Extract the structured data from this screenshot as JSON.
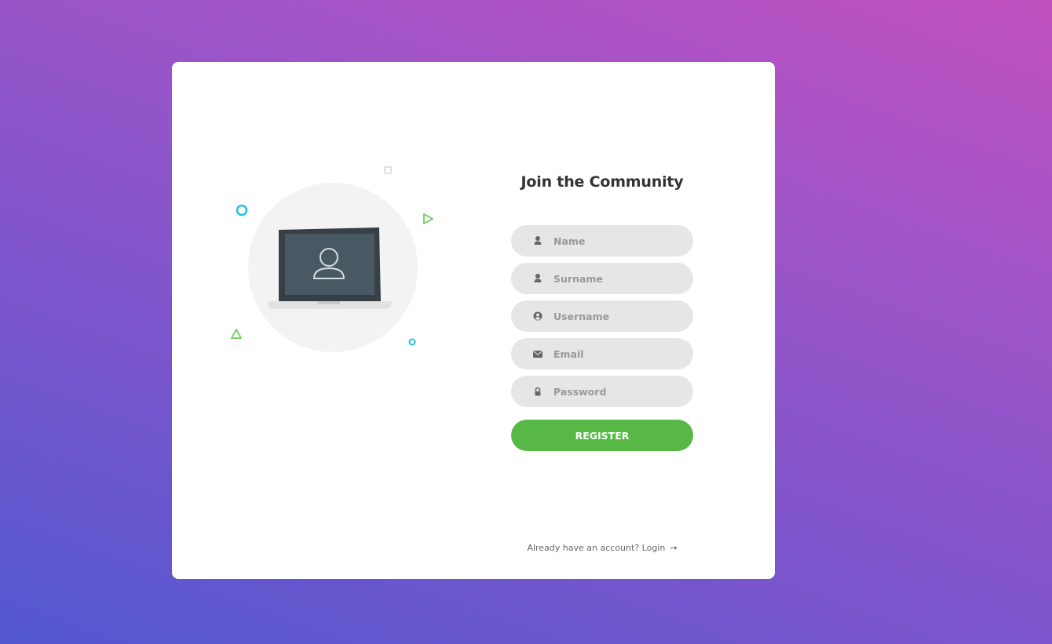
{
  "form": {
    "title": "Join the Community",
    "fields": [
      {
        "placeholder": "Name",
        "icon": "user-icon"
      },
      {
        "placeholder": "Surname",
        "icon": "user-icon"
      },
      {
        "placeholder": "Username",
        "icon": "user-circle-icon"
      },
      {
        "placeholder": "Email",
        "icon": "envelope-icon"
      },
      {
        "placeholder": "Password",
        "icon": "lock-icon"
      }
    ],
    "register_label": "REGISTER"
  },
  "footer": {
    "login_prompt": "Already have an account? Login",
    "arrow": "→"
  },
  "illustration": {
    "icon": "laptop-user-icon"
  },
  "colors": {
    "accent_green": "#57b846",
    "field_bg": "#e6e6e6",
    "decor_cyan": "#1fc0e0",
    "decor_green": "#7ad06a",
    "gradient_start": "#5258d0",
    "gradient_end": "#c050c0"
  }
}
